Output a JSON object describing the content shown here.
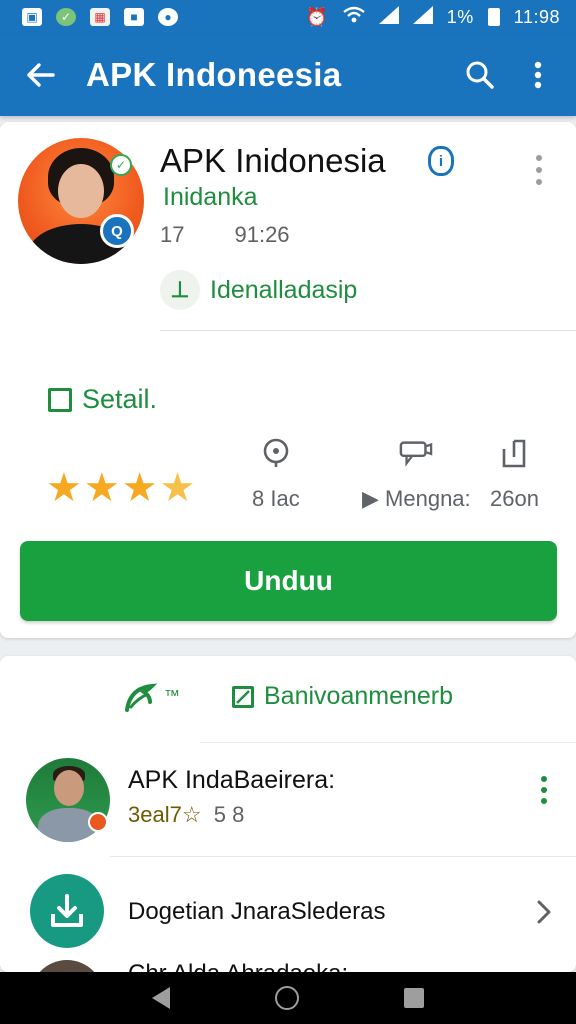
{
  "status_bar": {
    "battery": "1%",
    "time": "11:98",
    "icons": [
      "gallery-icon",
      "shield-icon",
      "image-icon",
      "notification-icon",
      "record-icon",
      "alarm-icon",
      "wifi-icon",
      "signal-icon",
      "signal-icon",
      "battery-icon"
    ]
  },
  "app_bar": {
    "title": "APK Indoneesia",
    "back_icon": "arrow-left",
    "actions": [
      "search",
      "more-vertical"
    ]
  },
  "app": {
    "name": "APK Inidonesia",
    "developer": "Inidanka",
    "meta_left": "17",
    "meta_right": "91:26",
    "category": "Idenalladasip",
    "category_icon_glyph": "⊥",
    "detail_label": "Setail.",
    "rating_stars": 3.5,
    "stats": [
      {
        "icon": "location-pin",
        "label": "8 Iac"
      },
      {
        "icon": "play",
        "label": "▶ Mengna:"
      },
      {
        "icon": "share",
        "label": "26on"
      }
    ],
    "install_label": "Unduu"
  },
  "tabs": {
    "a_label": "™",
    "b_label": "Banivoanmenerb"
  },
  "list": [
    {
      "title": "APK IndaBaeirera:",
      "subtitle": "3eal7☆",
      "extra": "5 8"
    },
    {
      "title": "Dogetian JnaraSlederas",
      "action": "chevron-right"
    },
    {
      "title": "Chr Alda Ahradaeka:"
    }
  ],
  "colors": {
    "primary": "#1a73bd",
    "accent_green": "#1e8e3e",
    "install_green": "#1aa13f",
    "star": "#f6a821"
  }
}
